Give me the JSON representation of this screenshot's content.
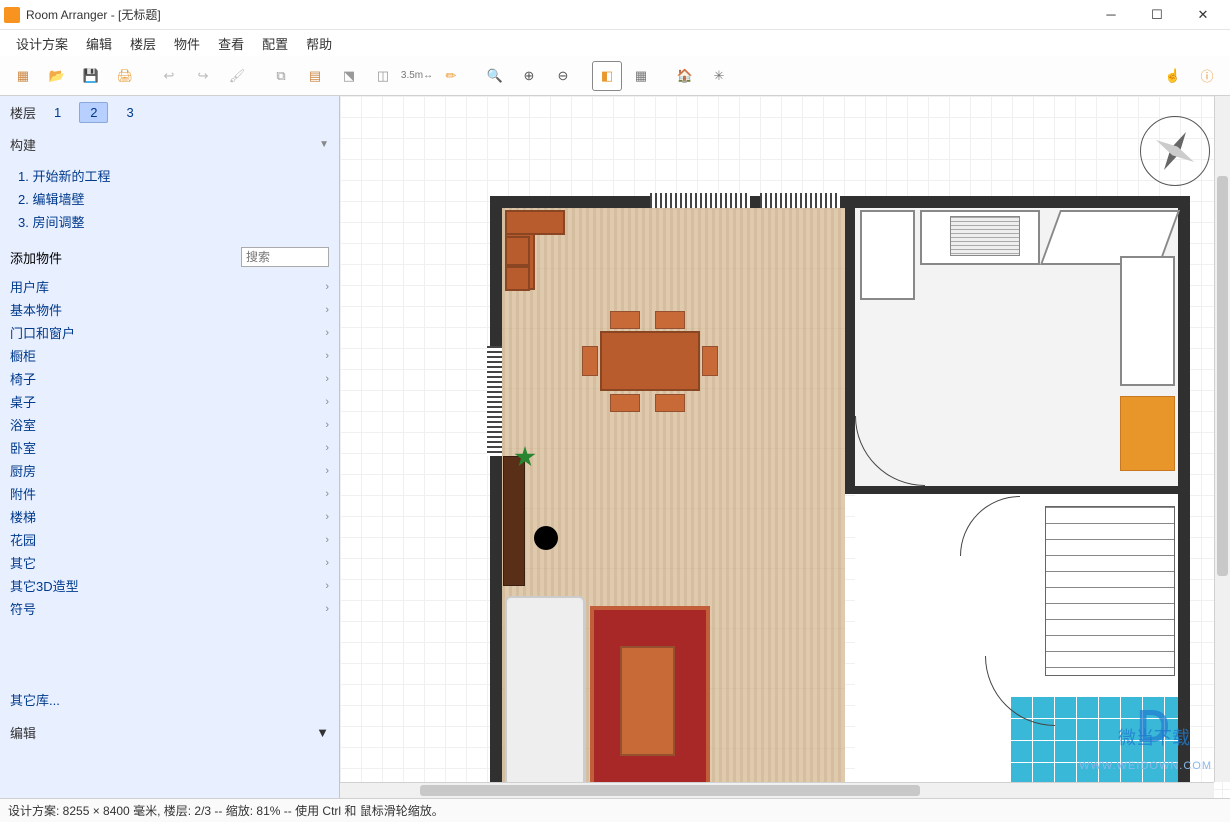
{
  "window": {
    "title": "Room Arranger - [无标题]"
  },
  "menu": {
    "items": [
      "设计方案",
      "编辑",
      "楼层",
      "物件",
      "查看",
      "配置",
      "帮助"
    ]
  },
  "toolbar": {
    "buttons": [
      {
        "name": "new-icon",
        "glyph": "▦"
      },
      {
        "name": "open-icon",
        "glyph": "📂"
      },
      {
        "name": "save-icon",
        "glyph": "💾"
      },
      {
        "name": "print-icon",
        "glyph": "🖨"
      },
      {
        "name": "undo-icon",
        "glyph": "↩"
      },
      {
        "name": "redo-icon",
        "glyph": "↪"
      },
      {
        "name": "brush-icon",
        "glyph": "✎"
      },
      {
        "name": "copy-area-icon",
        "glyph": "⧉"
      },
      {
        "name": "wall-icon",
        "glyph": "▤"
      },
      {
        "name": "measure-corner-icon",
        "glyph": "⬔"
      },
      {
        "name": "cube-icon",
        "glyph": "◫"
      },
      {
        "name": "dimension-icon",
        "glyph": "3.5m"
      },
      {
        "name": "marker-icon",
        "glyph": "✏"
      },
      {
        "name": "zoom-fit-icon",
        "glyph": "⊡"
      },
      {
        "name": "zoom-in-icon",
        "glyph": "⊕"
      },
      {
        "name": "zoom-out-icon",
        "glyph": "⊖"
      },
      {
        "name": "view-3d-icon",
        "glyph": "◧",
        "selected": true
      },
      {
        "name": "list-3d-icon",
        "glyph": "▦"
      },
      {
        "name": "home-icon",
        "glyph": "🏠"
      },
      {
        "name": "settings-icon",
        "glyph": "✳"
      }
    ],
    "right": [
      {
        "name": "touch-icon",
        "glyph": "☝"
      },
      {
        "name": "help-icon",
        "glyph": "ⓘ"
      }
    ]
  },
  "sidebar": {
    "layers_label": "楼层",
    "layers": [
      "1",
      "2",
      "3"
    ],
    "active_layer": 1,
    "build": {
      "title": "构建",
      "steps": [
        "1.  开始新的工程",
        "2.  编辑墙壁",
        "3.  房间调整"
      ]
    },
    "add_objects": {
      "title": "添加物件",
      "search_placeholder": "搜索"
    },
    "categories": [
      "用户库",
      "基本物件",
      "门口和窗户",
      "橱柜",
      "椅子",
      "桌子",
      "浴室",
      "卧室",
      "厨房",
      "附件",
      "楼梯",
      "花园",
      "其它",
      "其它3D造型",
      "符号"
    ],
    "other_lib": "其它库...",
    "edit": "编辑"
  },
  "statusbar": {
    "text": "设计方案: 8255 × 8400 毫米, 楼层: 2/3 -- 缩放: 81% -- 使用 Ctrl 和 鼠标滑轮缩放。"
  },
  "watermark": {
    "url": "WWW.WEIDOWN.COM",
    "name": "微当下载"
  }
}
